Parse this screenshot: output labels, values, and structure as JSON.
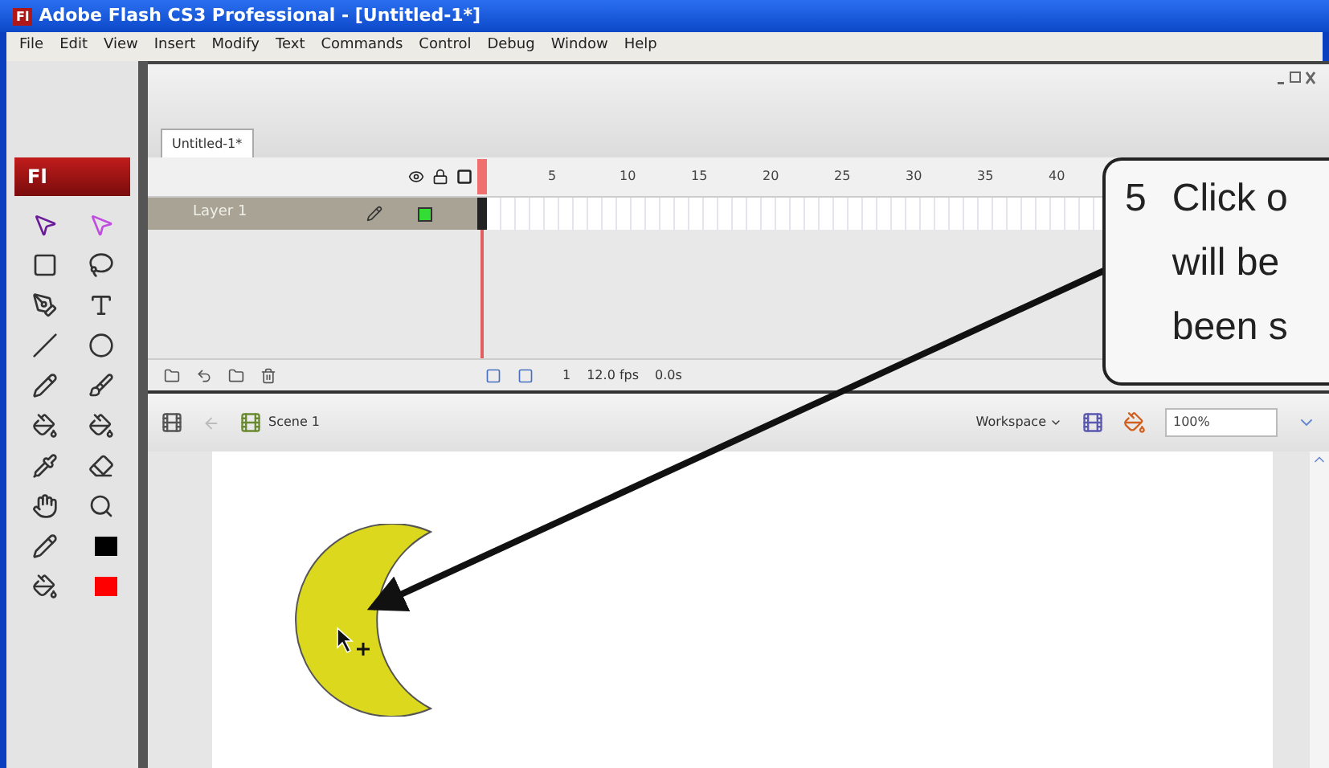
{
  "window": {
    "title": "Adobe Flash CS3 Professional - [Untitled-1*]",
    "app_badge": "Fl"
  },
  "menu": [
    "File",
    "Edit",
    "View",
    "Insert",
    "Modify",
    "Text",
    "Commands",
    "Control",
    "Debug",
    "Window",
    "Help"
  ],
  "toolbox": {
    "logo": "Fl"
  },
  "document_tab": {
    "label": "Untitled-1*",
    "selected": true
  },
  "timeline": {
    "frame_numbers": [
      "5",
      "10",
      "15",
      "20",
      "25",
      "30",
      "35",
      "40"
    ],
    "layers": [
      {
        "name": "Layer 1",
        "selected": true
      }
    ],
    "footer": {
      "frame": "1",
      "rate": "12.0 fps",
      "time": "0.0s"
    }
  },
  "edit_bar": {
    "scene": "Scene 1",
    "workspace": "Workspace",
    "zoom": "100%"
  },
  "callout": {
    "number": "5",
    "lines": [
      "Click o",
      "will be",
      "been s"
    ]
  }
}
